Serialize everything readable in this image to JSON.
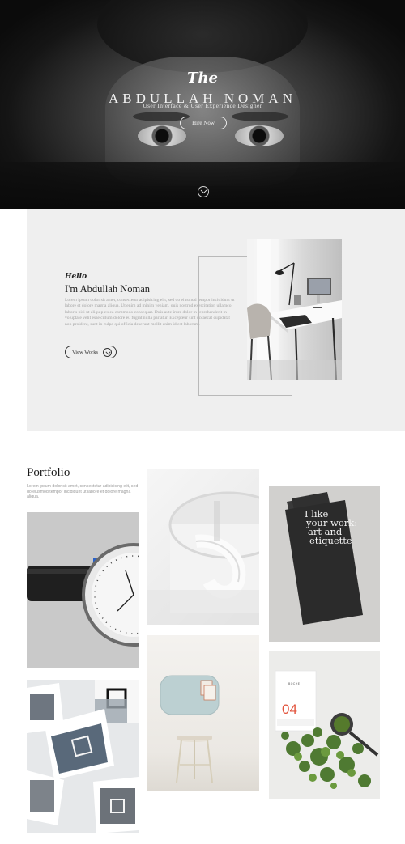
{
  "hero": {
    "script_title": "The",
    "name": "ABDULLAH NOMAN",
    "subtitle": "User Interface & User Experience Designer",
    "hire_button_label": "Hire Now"
  },
  "about": {
    "greeting": "Hello",
    "heading": "I'm Abdullah Noman",
    "body": "Lorem ipsum dolor sit amet, consectetur adipisicing elit, sed do eiusmod tempor incididunt ut labore et dolore magna aliqua. Ut enim ad minim veniam, quis nostrud exercitation ullamco laboris nisi ut aliquip ex ea commodo consequat. Duis aute irure dolor in reprehenderit in voluptate velit esse cillum dolore eu fugiat nulla pariatur. Excepteur sint occaecat cupidatat non proident, sunt in culpa qui officia deserunt mollit anim id est laborum.",
    "works_button_label": "View Works"
  },
  "portfolio": {
    "title": "Portfolio",
    "description": "Lorem ipsum dolor sit amet, consectetur adipisicing elit, sed do eiusmod tempor incididunt ut labore et dolore magna aliqua.",
    "book_cover_text": [
      "I like",
      "your work:",
      "art and",
      "etiquette"
    ],
    "card_word": "BOCHE",
    "card_number": "04"
  },
  "colors": {
    "about_background": "#efefef",
    "card_accent": "#e2533c"
  }
}
